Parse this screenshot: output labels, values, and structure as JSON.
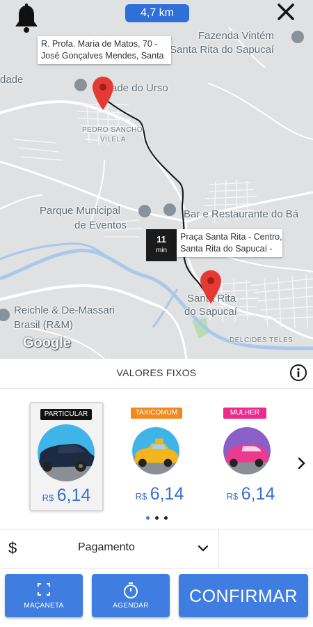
{
  "map": {
    "distance": "4,7 km",
    "origin_address": [
      "R. Profa. Maria de Matos, 70 -",
      "José Gonçalves Mendes, Santa"
    ],
    "destination_address": [
      "Praça Santa Rita - Centro,",
      "Santa Rita do Sapucaí -"
    ],
    "time_value": "11",
    "time_unit": "min",
    "places": {
      "fazenda_line1": "Fazenda Vintém",
      "fazenda_line2": "Santa Rita do Sapucaí",
      "dade": "dade",
      "urso": "ade do Urso",
      "pedro_line1": "PEDRO SANCHO",
      "pedro_line2": "VILELA",
      "parque_line1": "Parque Municipal",
      "parque_line2": "de Eventos",
      "bar": "Bar e Restaurante do Bá",
      "santa_rita_line1": "Santa Rita",
      "santa_rita_line2": "do Sapucaí",
      "reichle_line1": "Reichle & De-Massari",
      "reichle_line2": "Brasil (R&M)",
      "delcides": "DELCIDES TELES"
    },
    "google_logo": "Google"
  },
  "panel": {
    "title": "VALORES FIXOS",
    "options": [
      {
        "badge": "PARTICULAR",
        "currency": "R$",
        "price": "6,14",
        "selected": true,
        "badge_color": "#111111"
      },
      {
        "badge": "TAXICOMUM",
        "currency": "R$",
        "price": "6,14",
        "selected": false,
        "badge_color": "#f08a1e"
      },
      {
        "badge": "MULHER",
        "currency": "R$",
        "price": "6,14",
        "selected": false,
        "badge_color": "#ea2c8e"
      }
    ],
    "pager": {
      "pages": 3,
      "current": 1
    }
  },
  "payment": {
    "icon": "$",
    "label": "Pagamento"
  },
  "actions": {
    "macaneta": "MAÇANETA",
    "agendar": "AGENDAR",
    "confirmar": "CONFIRMAR"
  },
  "colors": {
    "accent": "#3f7de0",
    "price": "#3a6fcf",
    "pin": "#e53935"
  }
}
